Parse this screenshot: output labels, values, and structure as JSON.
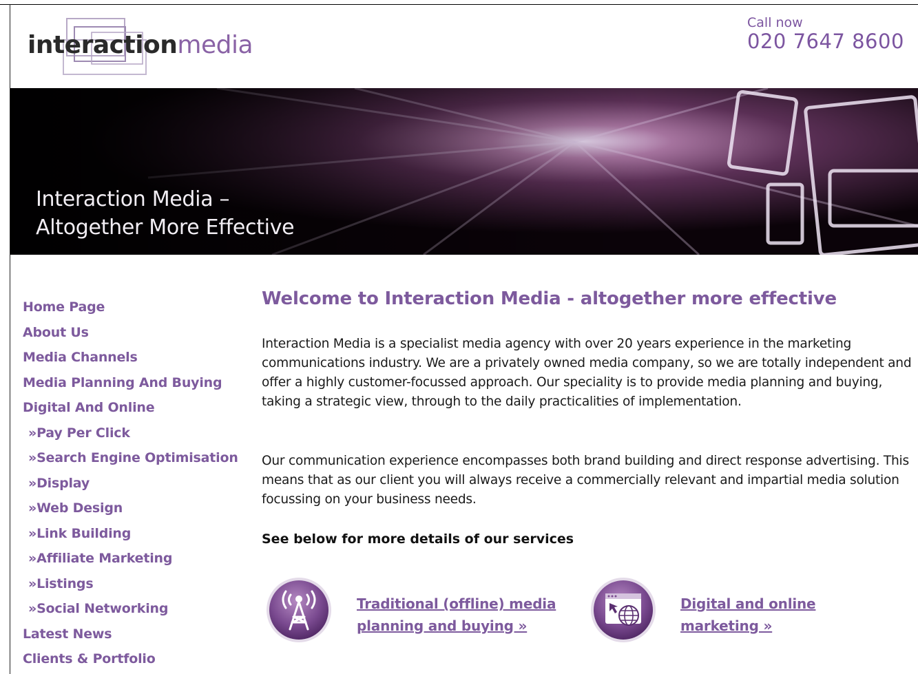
{
  "header": {
    "logo_bold": "interaction",
    "logo_light": "media",
    "call_label": "Call now",
    "call_number": "020 7647 8600"
  },
  "banner": {
    "line1": "Interaction Media –",
    "line2": "Altogether More Effective"
  },
  "nav": {
    "items": [
      {
        "label": "Home Page"
      },
      {
        "label": "About Us"
      },
      {
        "label": "Media Channels"
      },
      {
        "label": "Media Planning And Buying"
      },
      {
        "label": "Digital And Online"
      },
      {
        "label": "»Pay Per Click"
      },
      {
        "label": "»Search Engine Optimisation"
      },
      {
        "label": "»Display"
      },
      {
        "label": "»Web Design"
      },
      {
        "label": "»Link Building"
      },
      {
        "label": "»Affiliate Marketing"
      },
      {
        "label": "»Listings"
      },
      {
        "label": "»Social Networking"
      },
      {
        "label": "Latest News"
      },
      {
        "label": "Clients & Portfolio"
      }
    ]
  },
  "main": {
    "heading": "Welcome to Interaction Media - altogether more effective",
    "paragraph1": "Interaction Media is a specialist media agency with over 20 years experience in the marketing communications industry. We are a privately owned media company, so we are totally independent and offer a highly customer-focussed approach. Our speciality is to provide media planning and buying, taking a strategic view, through to the daily practicalities of implementation.",
    "paragraph2": "Our communication experience encompasses both brand building and direct response advertising. This means that as our client you will always receive a commercially relevant and impartial media solution focussing on your business needs.",
    "services_heading": "See below for more details of our services",
    "services": [
      {
        "icon": "broadcast-tower-icon",
        "line1": "Traditional (offline) media",
        "line2": "planning and buying »"
      },
      {
        "icon": "web-globe-icon",
        "line1": "Digital and online",
        "line2": "marketing »"
      }
    ]
  },
  "colors": {
    "accent": "#7d5a9d",
    "banner_bg": "#0a0308",
    "text": "#1a1a1a"
  }
}
